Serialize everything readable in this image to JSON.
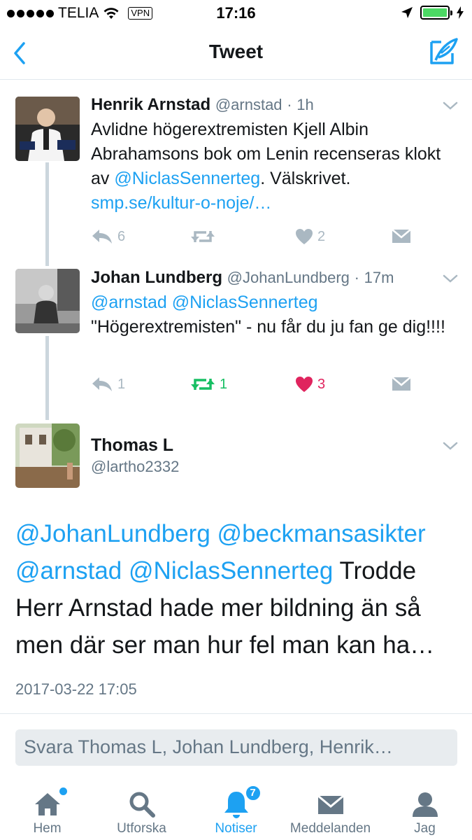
{
  "status_bar": {
    "carrier": "TELIA",
    "vpn": "VPN",
    "time": "17:16"
  },
  "nav": {
    "title": "Tweet"
  },
  "tweets": [
    {
      "name": "Henrik Arnstad",
      "handle": "@arnstad",
      "age": "1h",
      "text_pre": "Avlidne högerextremisten Kjell Albin Abrahamsons bok om Lenin recenseras klokt av ",
      "mention": "@NiclasSennerteg",
      "text_post": ". Välskrivet.",
      "url": "smp.se/kultur-o-noje/…",
      "replies": "6",
      "retweets": "",
      "likes": "2"
    },
    {
      "name": "Johan Lundberg",
      "handle": "@JohanLundberg",
      "age": "17m",
      "mention1": "@arnstad",
      "mention2": "@NiclasSennerteg",
      "text": "\"Högerextremisten\" - nu får du ju fan ge dig!!!!",
      "replies": "1",
      "retweets": "1",
      "likes": "3"
    }
  ],
  "focused": {
    "name": "Thomas L",
    "handle": "@lartho2332",
    "mention1": "@JohanLundberg",
    "mention2": "@beckmansasikter",
    "mention3": "@arnstad",
    "mention4": "@NiclasSennerteg",
    "text": " Trodde Herr Arnstad hade mer bildning än så men där ser man hur fel man kan ha…",
    "timestamp": "2017-03-22 17:05"
  },
  "reply_box": {
    "placeholder": "Svara Thomas L, Johan Lundberg, Henrik…"
  },
  "tabbar": {
    "home": "Hem",
    "explore": "Utforska",
    "notifications": "Notiser",
    "notifications_badge": "7",
    "messages": "Meddelanden",
    "me": "Jag"
  },
  "colors": {
    "accent": "#1da1f2",
    "retweet": "#17bf63",
    "like": "#e0245e",
    "muted": "#aab8c2"
  },
  "icons": {
    "back": "chevron-left-icon",
    "compose": "compose-tweet-icon",
    "reply": "reply-icon",
    "retweet": "retweet-icon",
    "like": "heart-icon",
    "dm": "envelope-icon"
  }
}
